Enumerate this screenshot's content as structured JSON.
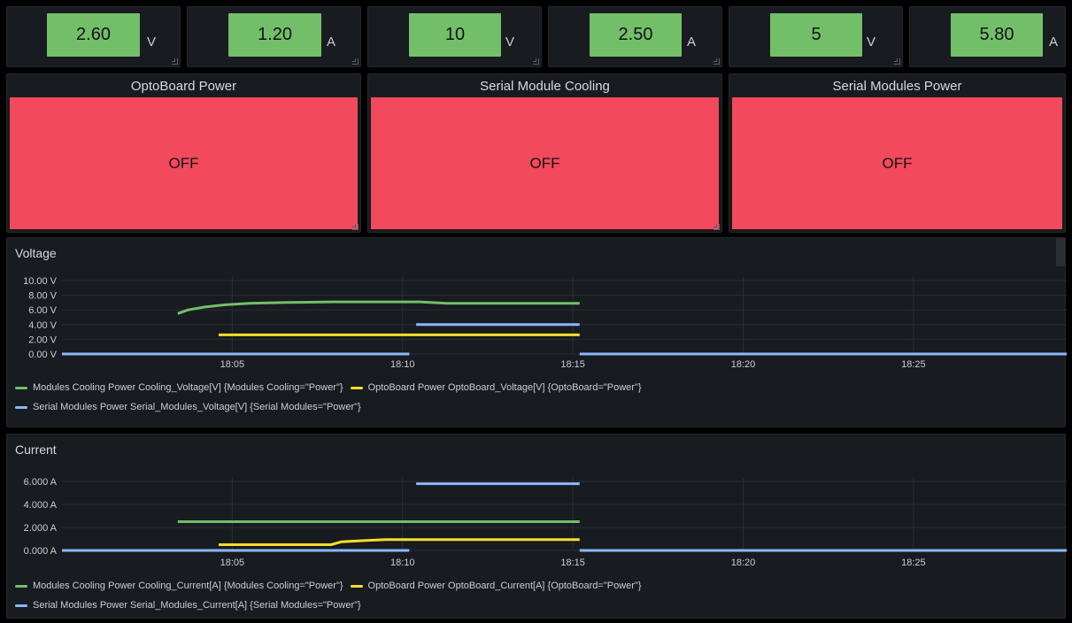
{
  "stats": [
    {
      "value": "2.60",
      "unit": "V"
    },
    {
      "value": "1.20",
      "unit": "A"
    },
    {
      "value": "10",
      "unit": "V"
    },
    {
      "value": "2.50",
      "unit": "A"
    },
    {
      "value": "5",
      "unit": "V"
    },
    {
      "value": "5.80",
      "unit": "A"
    }
  ],
  "status": [
    {
      "title": "OptoBoard Power",
      "state": "OFF"
    },
    {
      "title": "Serial Module Cooling",
      "state": "OFF"
    },
    {
      "title": "Serial Modules Power",
      "state": "OFF"
    }
  ],
  "colors": {
    "green": "#73bf69",
    "yellow": "#fade2a",
    "blue": "#8ab8ff",
    "red": "#f2495c"
  },
  "chart_data": [
    {
      "type": "line",
      "title": "Voltage",
      "y_ticks": [
        "10.00 V",
        "8.00 V",
        "6.00 V",
        "4.00 V",
        "2.00 V",
        "0.00 V"
      ],
      "x_ticks": [
        "18:05",
        "18:10",
        "18:15",
        "18:20",
        "18:25"
      ],
      "ylim": [
        0,
        10
      ],
      "xlim": [
        "18:00",
        "18:29.5"
      ],
      "series": [
        {
          "name": "Modules Cooling Power Cooling_Voltage[V] {Modules Cooling=\"Power\"}",
          "color": "#73bf69",
          "points": [
            [
              "18:03.4",
              5.5
            ],
            [
              "18:03.7",
              6.0
            ],
            [
              "18:04.2",
              6.4
            ],
            [
              "18:04.8",
              6.7
            ],
            [
              "18:05.5",
              6.9
            ],
            [
              "18:06.5",
              7.0
            ],
            [
              "18:08",
              7.1
            ],
            [
              "18:10.5",
              7.1
            ],
            [
              "18:11.3",
              6.9
            ],
            [
              "18:15.2",
              6.9
            ]
          ]
        },
        {
          "name": "OptoBoard Power OptoBoard_Voltage[V] {OptoBoard=\"Power\"}",
          "color": "#fade2a",
          "points": [
            [
              "18:04.6",
              2.6
            ],
            [
              "18:15.2",
              2.6
            ]
          ]
        },
        {
          "name": "Serial Modules Power Serial_Modules_Voltage[V] {Serial Modules=\"Power\"}",
          "color": "#8ab8ff",
          "segments": [
            [
              [
                "18:00",
                0
              ],
              [
                "18:10.2",
                0
              ]
            ],
            [
              [
                "18:10.4",
                4
              ],
              [
                "18:15.2",
                4
              ]
            ],
            [
              [
                "18:15.2",
                0
              ],
              [
                "18:29.5",
                0
              ]
            ]
          ]
        }
      ]
    },
    {
      "type": "line",
      "title": "Current",
      "y_ticks": [
        "6.000 A",
        "4.000 A",
        "2.000 A",
        "0.000 A"
      ],
      "x_ticks": [
        "18:05",
        "18:10",
        "18:15",
        "18:20",
        "18:25"
      ],
      "ylim": [
        0,
        6
      ],
      "xlim": [
        "18:00",
        "18:29.5"
      ],
      "series": [
        {
          "name": "Modules Cooling Power Cooling_Current[A] {Modules Cooling=\"Power\"}",
          "color": "#73bf69",
          "points": [
            [
              "18:03.4",
              2.5
            ],
            [
              "18:15.2",
              2.5
            ]
          ]
        },
        {
          "name": "OptoBoard Power OptoBoard_Current[A] {OptoBoard=\"Power\"}",
          "color": "#fade2a",
          "points": [
            [
              "18:04.6",
              0.5
            ],
            [
              "18:07.9",
              0.5
            ],
            [
              "18:08.2",
              0.75
            ],
            [
              "18:08.8",
              0.85
            ],
            [
              "18:09.5",
              0.95
            ],
            [
              "18:15.2",
              0.95
            ]
          ]
        },
        {
          "name": "Serial Modules Power Serial_Modules_Current[A] {Serial Modules=\"Power\"}",
          "color": "#8ab8ff",
          "segments": [
            [
              [
                "18:00",
                0
              ],
              [
                "18:10.2",
                0
              ]
            ],
            [
              [
                "18:10.4",
                5.8
              ],
              [
                "18:15.2",
                5.8
              ]
            ],
            [
              [
                "18:15.2",
                0
              ],
              [
                "18:29.5",
                0
              ]
            ]
          ]
        }
      ]
    }
  ]
}
